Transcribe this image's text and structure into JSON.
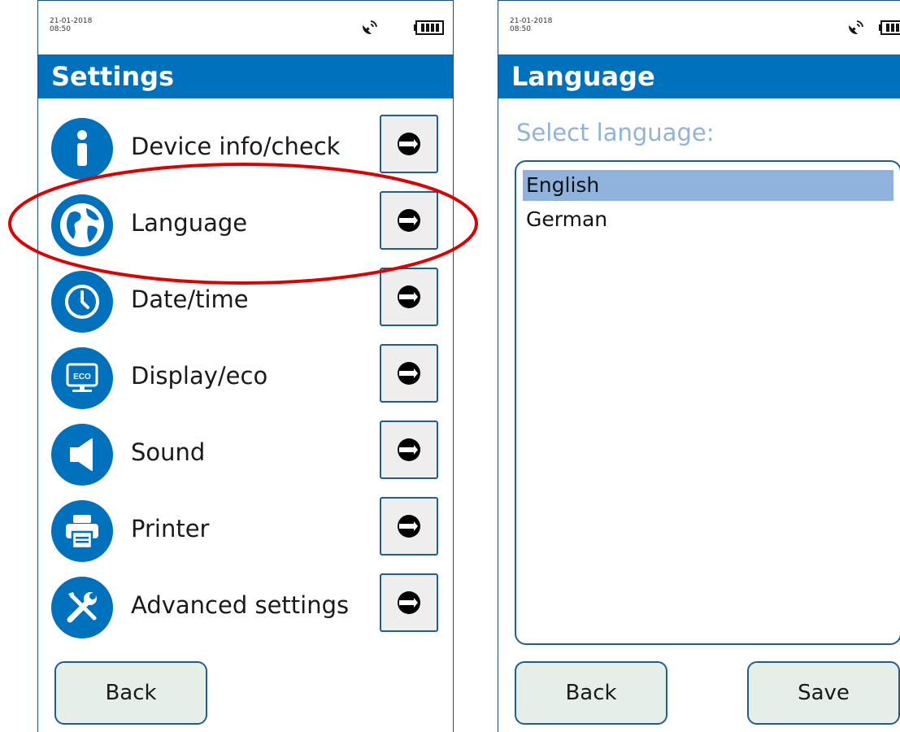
{
  "left_screen": {
    "status": {
      "date": "21-01-2018",
      "time": "08:50"
    },
    "title": "Settings",
    "menu_items": [
      {
        "label": "Device info/check",
        "icon": "info-icon"
      },
      {
        "label": "Language",
        "icon": "globe-icon"
      },
      {
        "label": "Date/time",
        "icon": "clock-icon"
      },
      {
        "label": "Display/eco",
        "icon": "eco-monitor-icon"
      },
      {
        "label": "Sound",
        "icon": "speaker-icon"
      },
      {
        "label": "Printer",
        "icon": "printer-icon"
      },
      {
        "label": "Advanced settings",
        "icon": "tools-icon"
      }
    ],
    "back_label": "Back",
    "highlight": "Language"
  },
  "right_screen": {
    "status": {
      "date": "21-01-2018",
      "time": "08:50"
    },
    "title": "Language",
    "subheading": "Select language:",
    "languages": [
      "English",
      "German"
    ],
    "selected_language": "English",
    "back_label": "Back",
    "save_label": "Save"
  },
  "colors": {
    "title_bar": "#0071bc",
    "icon_circle": "#0071bc",
    "button_fill": "#e6efe7",
    "selection": "#8fb3dc",
    "highlight_ellipse": "#e00000"
  }
}
